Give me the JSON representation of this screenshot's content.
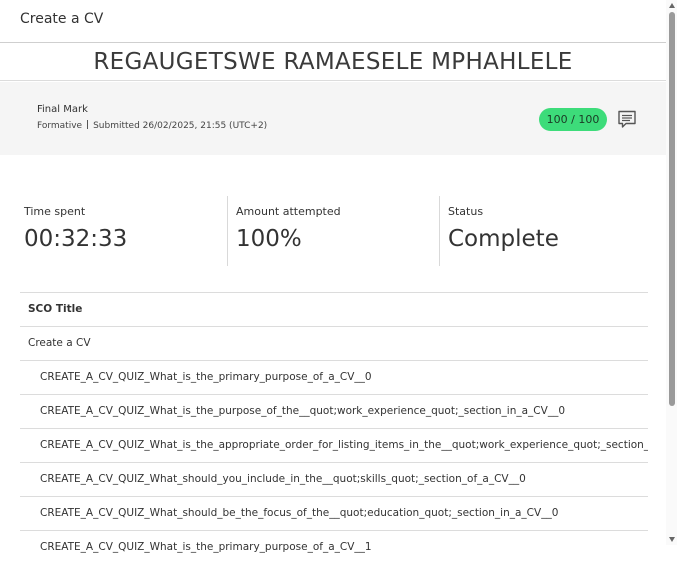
{
  "window": {
    "title": "Create a CV"
  },
  "learner": {
    "name": "REGAUGETSWE RAMAESELE MPHAHLELE"
  },
  "summary": {
    "final_label": "Final Mark",
    "type": "Formative",
    "submitted": "Submitted 26/02/2025, 21:55 (UTC+2)",
    "grade": "100 / 100",
    "grade_color": "#3ddc7a",
    "comment_icon": "comment-icon"
  },
  "stats": {
    "time_spent": {
      "label": "Time spent",
      "value": "00:32:33"
    },
    "amount_attempted": {
      "label": "Amount attempted",
      "value": "100%"
    },
    "status": {
      "label": "Status",
      "value": "Complete"
    }
  },
  "table": {
    "header": "SCO Title",
    "rows": [
      "Create a CV",
      "CREATE_A_CV_QUIZ_What_is_the_primary_purpose_of_a_CV__0",
      "CREATE_A_CV_QUIZ_What_is_the_purpose_of_the__quot;work_experience_quot;_section_in_a_CV__0",
      "CREATE_A_CV_QUIZ_What_is_the_appropriate_order_for_listing_items_in_the__quot;work_experience_quot;_section_of",
      "CREATE_A_CV_QUIZ_What_should_you_include_in_the__quot;skills_quot;_section_of_a_CV__0",
      "CREATE_A_CV_QUIZ_What_should_be_the_focus_of_the__quot;education_quot;_section_in_a_CV__0",
      "CREATE_A_CV_QUIZ_What_is_the_primary_purpose_of_a_CV__1"
    ]
  }
}
